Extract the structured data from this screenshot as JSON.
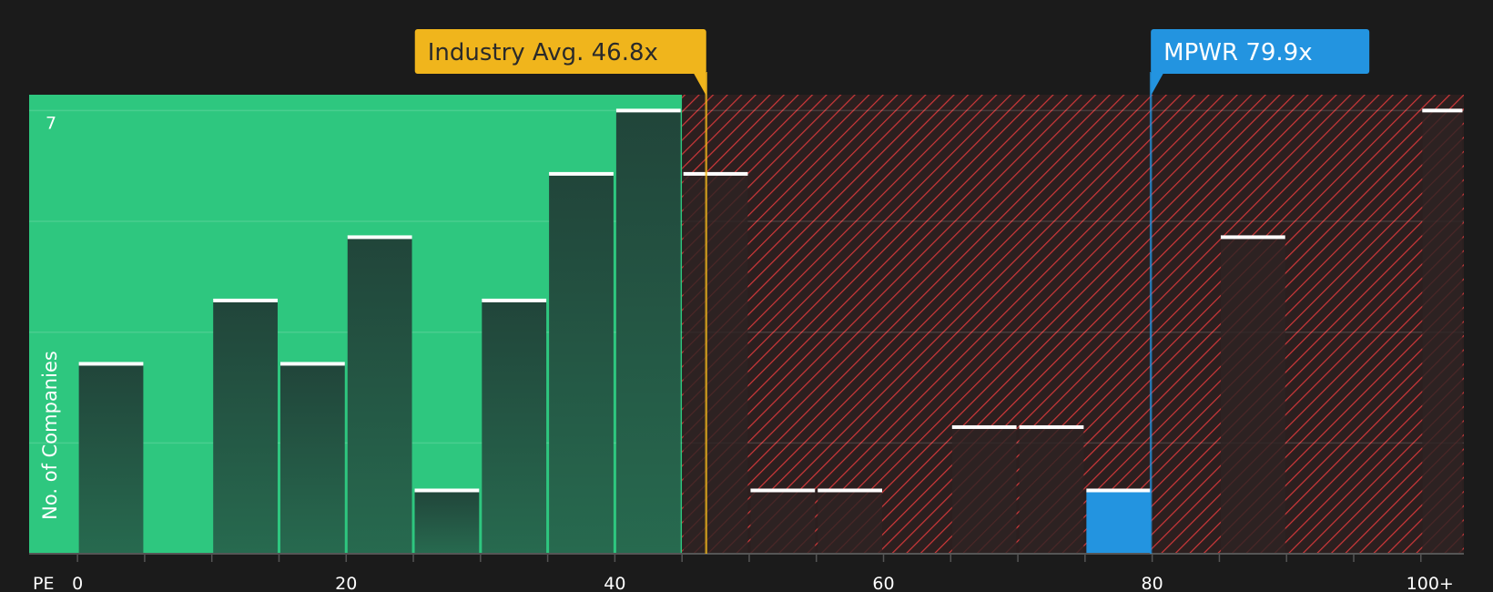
{
  "chart_data": {
    "type": "bar",
    "x_axis_label": "PE",
    "y_axis_label": "No. of Companies",
    "bin_width": 5,
    "xlim": [
      -3.6,
      103.2
    ],
    "ylim": [
      0,
      7.25
    ],
    "x_ticks": [
      {
        "value": 0,
        "label": "0"
      },
      {
        "value": 20,
        "label": "20"
      },
      {
        "value": 40,
        "label": "40"
      },
      {
        "value": 60,
        "label": "60"
      },
      {
        "value": 80,
        "label": "80"
      },
      {
        "value": 100,
        "label": "100+"
      }
    ],
    "y_ticks": [
      {
        "value": 7,
        "label": "7"
      }
    ],
    "bins": [
      {
        "start": 0,
        "count": 3
      },
      {
        "start": 5,
        "count": 0
      },
      {
        "start": 10,
        "count": 4
      },
      {
        "start": 15,
        "count": 3
      },
      {
        "start": 20,
        "count": 5
      },
      {
        "start": 25,
        "count": 1
      },
      {
        "start": 30,
        "count": 4
      },
      {
        "start": 35,
        "count": 6
      },
      {
        "start": 40,
        "count": 7
      },
      {
        "start": 45,
        "count": 6
      },
      {
        "start": 50,
        "count": 1
      },
      {
        "start": 55,
        "count": 1
      },
      {
        "start": 60,
        "count": 0
      },
      {
        "start": 65,
        "count": 2
      },
      {
        "start": 70,
        "count": 2
      },
      {
        "start": 75,
        "count": 1
      },
      {
        "start": 80,
        "count": 0
      },
      {
        "start": 85,
        "count": 5
      },
      {
        "start": 90,
        "count": 0
      },
      {
        "start": 95,
        "count": 0
      },
      {
        "start": 100,
        "count": 7
      }
    ],
    "highlight_bin_start": 75,
    "undervalued_region": [
      -3.6,
      45
    ],
    "overvalued_region": [
      45,
      103.2
    ],
    "industry_avg": {
      "value": 46.8,
      "label": "Industry Avg. 46.8x"
    },
    "company": {
      "value": 79.9,
      "label": "MPWR 79.9x"
    },
    "colors": {
      "background": "#1b1b1b",
      "undervalued": "#2ec77f",
      "overvalued": "#2c1f1f",
      "hatch": "#d0383a",
      "bar_green_top": "#21453a",
      "bar_green_bottom": "#276a4f",
      "bar_red": "#2d2323",
      "highlight": "#2394e0",
      "industry": "#f0b51c",
      "company": "#2394e0",
      "gridline": "rgba(255,255,255,0.13)",
      "axis": "#555555"
    }
  }
}
